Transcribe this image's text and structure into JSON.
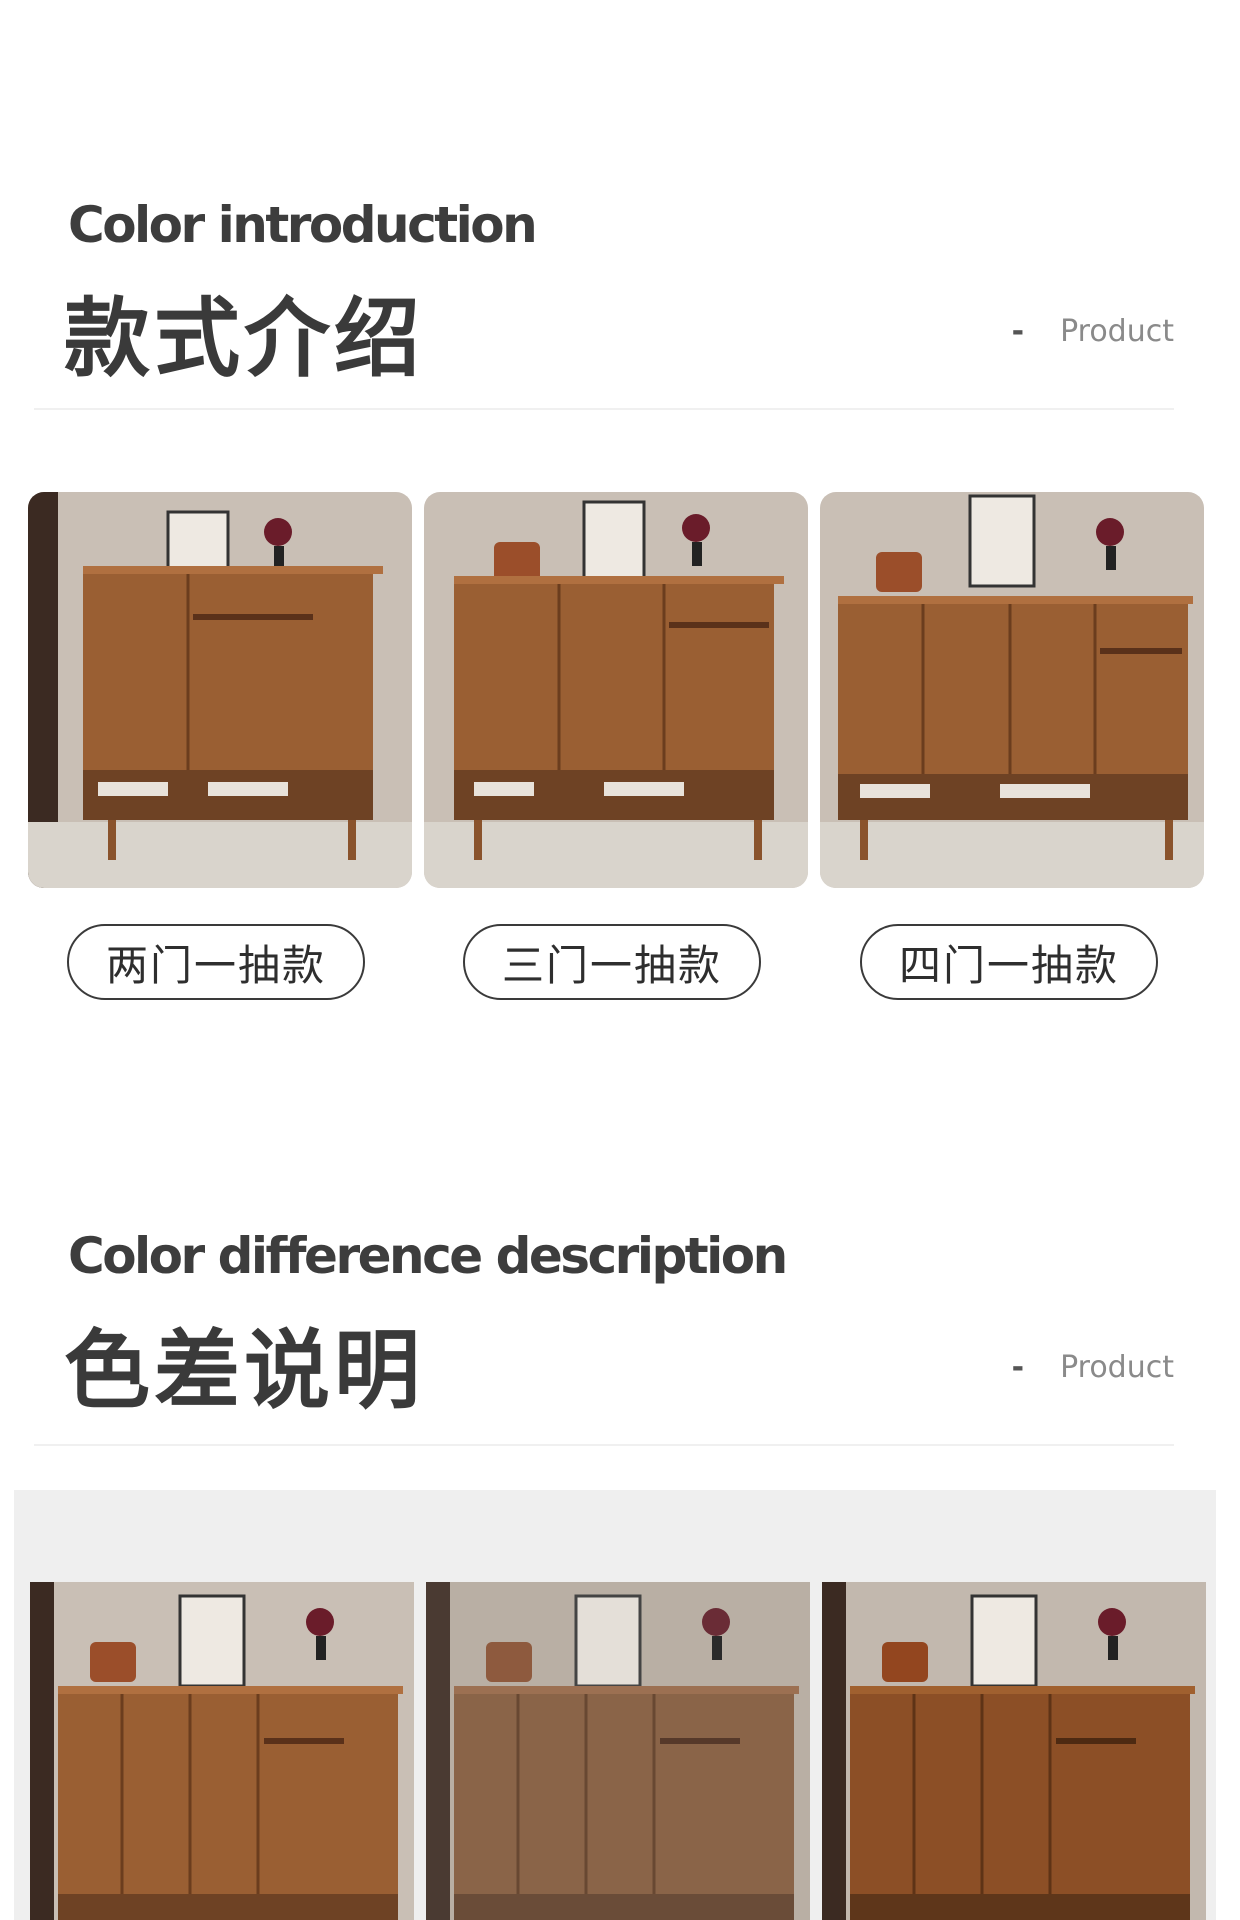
{
  "style_section": {
    "en_title": "Color introduction",
    "cn_title": "款式介绍",
    "tag_dash": "-",
    "tag_label": "Product",
    "options": [
      {
        "label": "两门一抽款",
        "image": "two-door-one-drawer-cabinet"
      },
      {
        "label": "三门一抽款",
        "image": "three-door-one-drawer-cabinet"
      },
      {
        "label": "四门一抽款",
        "image": "four-door-one-drawer-cabinet"
      }
    ]
  },
  "color_section": {
    "en_title": "Color difference description",
    "cn_title": "色差说明",
    "tag_dash": "-",
    "tag_label": "Product",
    "samples": [
      "walnut-standard",
      "walnut-faded",
      "walnut-dark"
    ]
  },
  "colors": {
    "wood": "#9a5f33",
    "wood_dark": "#7a4623",
    "wall": "#c9bfb5",
    "panel_bg": "#efefef",
    "text": "#3a3a3a"
  }
}
